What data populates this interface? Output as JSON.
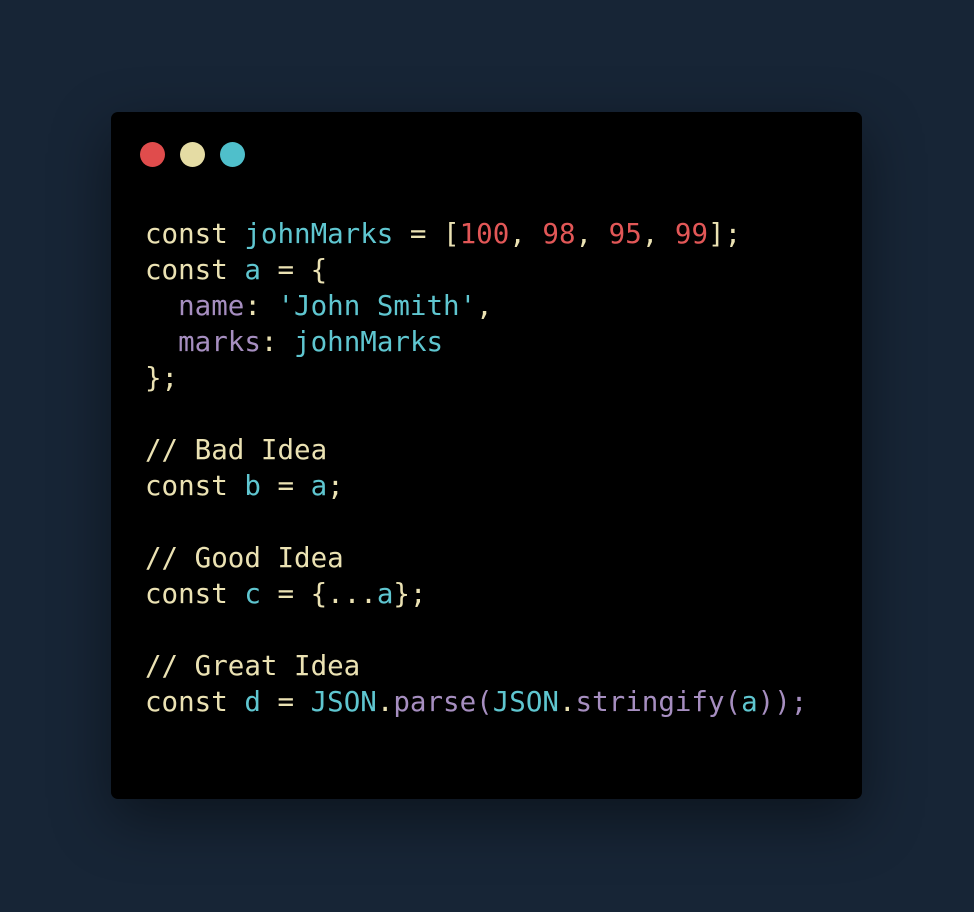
{
  "window_controls": {
    "close_color": "#e04c4c",
    "minimize_color": "#e5dca4",
    "zoom_color": "#4fbfcb"
  },
  "code_lines": [
    [
      [
        "const ",
        "kw"
      ],
      [
        "johnMarks",
        "id"
      ],
      [
        " = [",
        "punct"
      ],
      [
        "100",
        "num"
      ],
      [
        ", ",
        "punct"
      ],
      [
        "98",
        "num"
      ],
      [
        ", ",
        "punct"
      ],
      [
        "95",
        "num"
      ],
      [
        ", ",
        "punct"
      ],
      [
        "99",
        "num"
      ],
      [
        "];",
        "punct"
      ]
    ],
    [
      [
        "const ",
        "kw"
      ],
      [
        "a",
        "id"
      ],
      [
        " = {",
        "punct"
      ]
    ],
    [
      [
        "  ",
        "punct"
      ],
      [
        "name",
        "prop"
      ],
      [
        ": ",
        "punct"
      ],
      [
        "'John Smith'",
        "id"
      ],
      [
        ",",
        "punct"
      ]
    ],
    [
      [
        "  ",
        "punct"
      ],
      [
        "marks",
        "prop"
      ],
      [
        ": ",
        "punct"
      ],
      [
        "johnMarks",
        "id"
      ]
    ],
    [
      [
        "};",
        "punct"
      ]
    ],
    [],
    [
      [
        "// Bad Idea",
        "comment"
      ]
    ],
    [
      [
        "const ",
        "kw"
      ],
      [
        "b",
        "id"
      ],
      [
        " = ",
        "punct"
      ],
      [
        "a",
        "id"
      ],
      [
        ";",
        "punct"
      ]
    ],
    [],
    [
      [
        "// Good Idea",
        "comment"
      ]
    ],
    [
      [
        "const ",
        "kw"
      ],
      [
        "c",
        "id"
      ],
      [
        " = {...",
        "punct"
      ],
      [
        "a",
        "id"
      ],
      [
        "};",
        "punct"
      ]
    ],
    [],
    [
      [
        "// Great Idea",
        "comment"
      ]
    ],
    [
      [
        "const ",
        "kw"
      ],
      [
        "d",
        "id"
      ],
      [
        " = ",
        "punct"
      ],
      [
        "JSON",
        "id"
      ],
      [
        ".",
        "punct"
      ],
      [
        "parse",
        "prop"
      ],
      [
        "(",
        "prop"
      ],
      [
        "JSON",
        "id"
      ],
      [
        ".",
        "punct"
      ],
      [
        "stringify",
        "prop"
      ],
      [
        "(",
        "prop"
      ],
      [
        "a",
        "id"
      ],
      [
        "));",
        "prop"
      ]
    ]
  ]
}
